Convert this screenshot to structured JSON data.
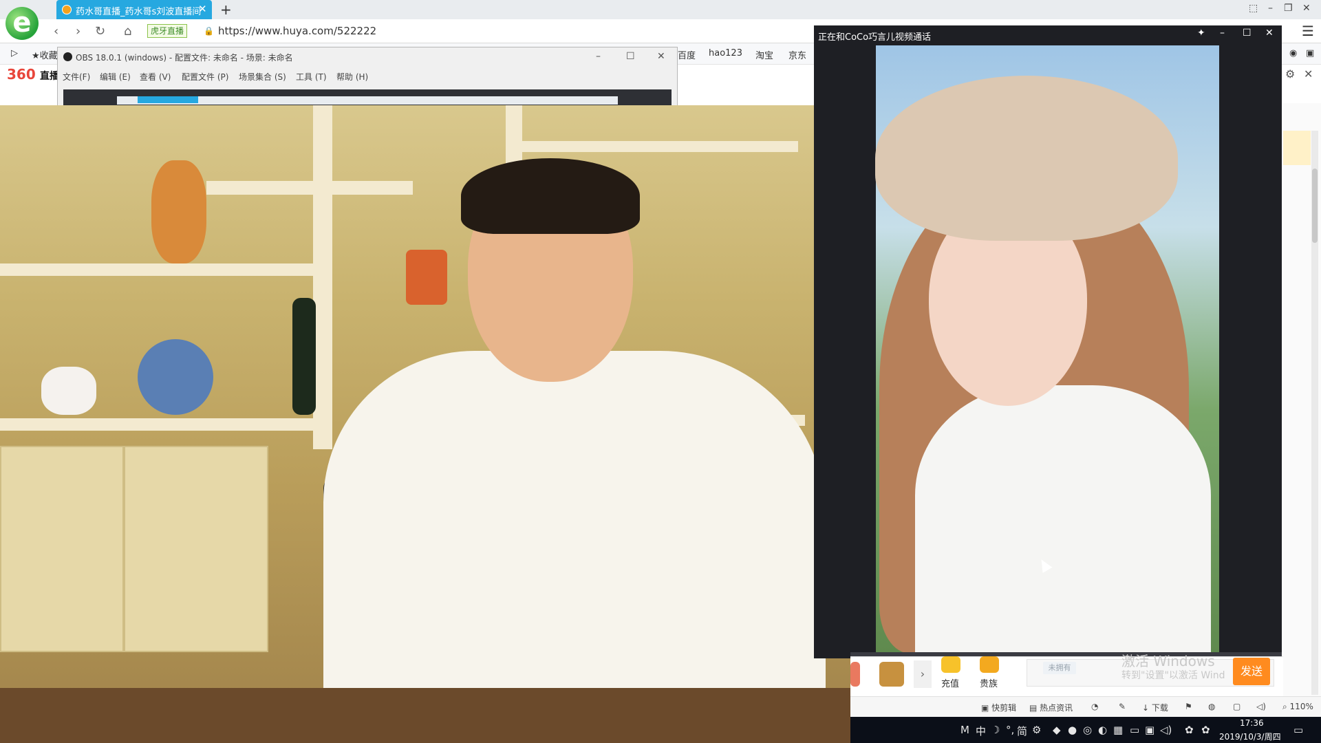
{
  "browser": {
    "tab_title": "药水哥直播_药水哥s刘波直播间",
    "tab_close": "✕",
    "new_tab": "+",
    "site_badge": "虎牙直播",
    "url": "https://www.huya.com/522222",
    "bookmarks": [
      {
        "label": "收藏"
      },
      {
        "label": "百度"
      },
      {
        "label": "hao123"
      },
      {
        "label": "淘宝"
      },
      {
        "label": "京东"
      }
    ],
    "site_logo": "360",
    "site_logo_suffix": "直播"
  },
  "obs": {
    "title": "OBS 18.0.1 (windows) - 配置文件: 未命名 - 场景: 未命名",
    "menu": [
      "文件(F)",
      "编辑 (E)",
      "查看 (V)",
      "配置文件 (P)",
      "场景集合 (S)",
      "工具 (T)",
      "帮助 (H)"
    ]
  },
  "call": {
    "title": "正在和CoCo巧言儿视频通话"
  },
  "huya": {
    "gift_labels": [
      "充值",
      "贵族"
    ],
    "not_have_badge": "未拥有",
    "send_label": "发送",
    "watermark_line1": "激活 Windows",
    "watermark_line2": "转到\"设置\"以激活 Wind"
  },
  "statusbar": {
    "items": [
      "快剪辑",
      "热点资讯",
      "下载"
    ],
    "zoom": "110%"
  },
  "taskbar": {
    "ime": [
      "M",
      "中",
      "简"
    ],
    "time": "17:36",
    "date": "2019/10/3/周四"
  },
  "colors": {
    "tab_active": "#26a8e0",
    "send_button": "#ff8b1f",
    "taskbar": "#0b0f18"
  }
}
